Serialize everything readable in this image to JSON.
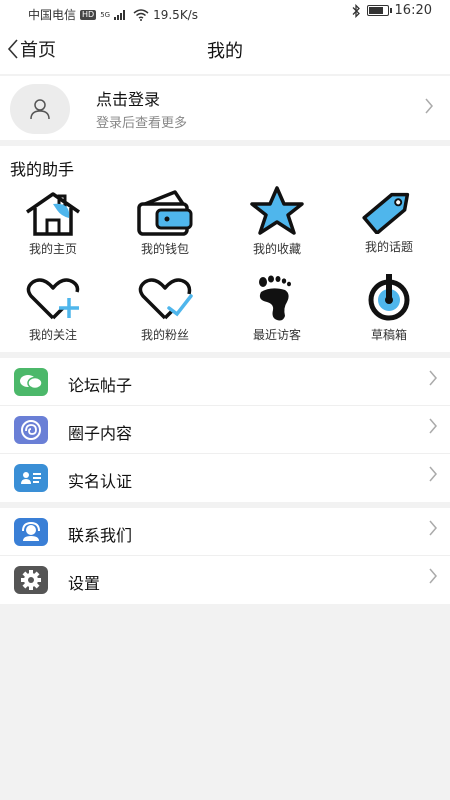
{
  "status_bar": {
    "carrier": "中国电信",
    "hd": "HD",
    "network": "5G",
    "speed": "19.5K/s",
    "time": "16:20"
  },
  "nav": {
    "back_label": "首页",
    "title": "我的"
  },
  "login": {
    "title": "点击登录",
    "subtitle": "登录后查看更多"
  },
  "helper": {
    "title": "我的助手",
    "items": [
      {
        "label": "我的主页",
        "icon": "home-icon"
      },
      {
        "label": "我的钱包",
        "icon": "wallet-icon"
      },
      {
        "label": "我的收藏",
        "icon": "star-icon"
      },
      {
        "label": "我的话题",
        "icon": "tag-icon"
      },
      {
        "label": "我的关注",
        "icon": "heart-plus-icon"
      },
      {
        "label": "我的粉丝",
        "icon": "heart-check-icon"
      },
      {
        "label": "最近访客",
        "icon": "footprint-icon"
      },
      {
        "label": "草稿箱",
        "icon": "draft-icon"
      }
    ]
  },
  "menu_group_1": [
    {
      "label": "论坛帖子",
      "icon": "chat-bubbles-icon",
      "color": "#4cb86a"
    },
    {
      "label": "圈子内容",
      "icon": "circle-swirl-icon",
      "color": "#6a7fd6"
    },
    {
      "label": "实名认证",
      "icon": "id-card-icon",
      "color": "#3a8fd6"
    }
  ],
  "menu_group_2": [
    {
      "label": "联系我们",
      "icon": "headset-icon",
      "color": "#3a7fd6"
    },
    {
      "label": "设置",
      "icon": "gear-icon",
      "color": "#555555"
    }
  ],
  "colors": {
    "accent_blue": "#4fb6ec",
    "text_primary": "#111111",
    "text_secondary": "#888888"
  }
}
